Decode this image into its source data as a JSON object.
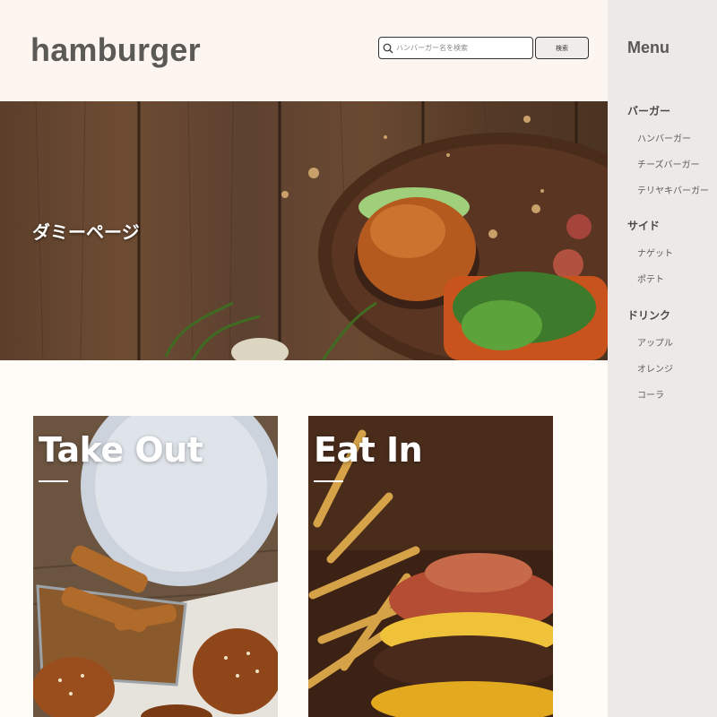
{
  "header": {
    "logo": "hamburger",
    "search": {
      "placeholder": "ハンバーガー名を検索",
      "value": ""
    },
    "search_button": "検索"
  },
  "hero": {
    "title": "ダミーページ"
  },
  "cards": [
    {
      "title": "Take Out"
    },
    {
      "title": "Eat In"
    }
  ],
  "sidebar": {
    "title": "Menu",
    "categories": [
      {
        "label": "バーガー",
        "items": [
          "ハンバーガー",
          "チーズバーガー",
          "テリヤキバーガー"
        ]
      },
      {
        "label": "サイド",
        "items": [
          "ナゲット",
          "ポテト"
        ]
      },
      {
        "label": "ドリンク",
        "items": [
          "アップル",
          "オレンジ",
          "コーラ"
        ]
      }
    ]
  },
  "colors": {
    "header_bg": "#fdf5ef",
    "page_bg": "#fffcf8",
    "sidebar_bg": "#ede9e6",
    "logo_text": "#5c5a57"
  },
  "icons": [
    "search-icon"
  ]
}
